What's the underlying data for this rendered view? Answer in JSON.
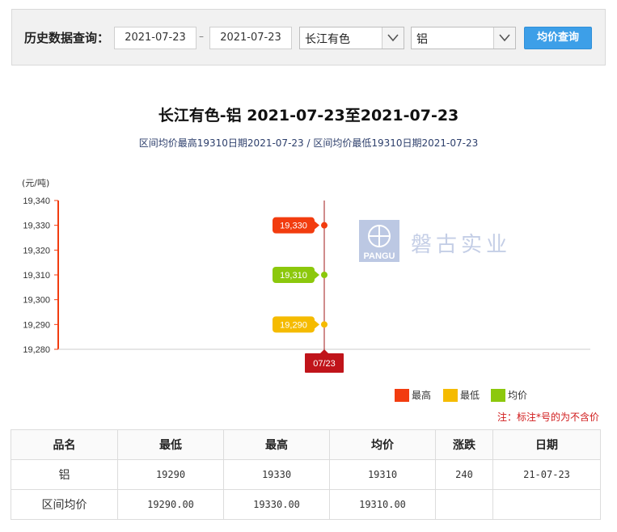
{
  "query": {
    "label": "历史数据查询：",
    "date_from": "2021-07-23",
    "date_separator": "–",
    "date_to": "2021-07-23",
    "market": "长江有色",
    "metal": "铝",
    "button": "均价查询"
  },
  "chart_header": {
    "title": "长江有色-铝 2021-07-23至2021-07-23",
    "subtitle": "区间均价最高19310日期2021-07-23 / 区间均价最低19310日期2021-07-23",
    "unit": "(元/吨)"
  },
  "watermark": {
    "text": "磐古实业",
    "logo_text": "PANGU"
  },
  "chart_data": {
    "type": "line",
    "categories": [
      "07/23"
    ],
    "ylim": [
      19280,
      19340
    ],
    "yticks": [
      19280,
      19290,
      19300,
      19310,
      19320,
      19330,
      19340
    ],
    "ylabel": "(元/吨)",
    "series": [
      {
        "name": "最高",
        "color": "#f23c0f",
        "values": [
          19330
        ]
      },
      {
        "name": "最低",
        "color": "#f5bb00",
        "values": [
          19290
        ]
      },
      {
        "name": "均价",
        "color": "#8cc80c",
        "values": [
          19310
        ]
      }
    ],
    "legend": "bottom-right"
  },
  "note": "注：标注*号的为不含价",
  "table": {
    "headers": [
      "品名",
      "最低",
      "最高",
      "均价",
      "涨跌",
      "日期"
    ],
    "rows": [
      [
        "铝",
        "19290",
        "19330",
        "19310",
        "240",
        "21-07-23"
      ],
      [
        "区间均价",
        "19290.00",
        "19330.00",
        "19310.00",
        "",
        ""
      ]
    ]
  }
}
